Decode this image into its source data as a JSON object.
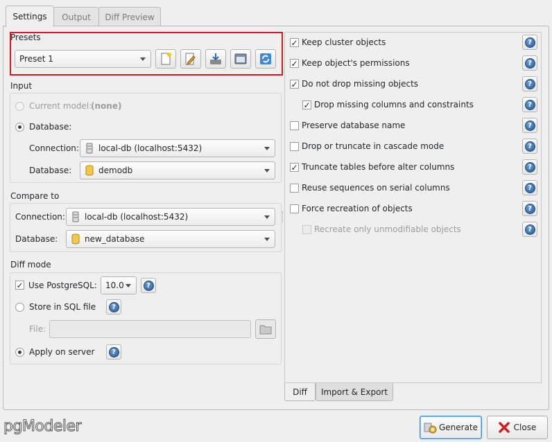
{
  "tabs": [
    {
      "label": "Settings",
      "active": true
    },
    {
      "label": "Output",
      "active": false
    },
    {
      "label": "Diff Preview",
      "active": false
    }
  ],
  "presets": {
    "title": "Presets",
    "selected": "Preset 1",
    "buttons": [
      "new-preset-icon",
      "edit-preset-icon",
      "save-preset-icon",
      "remove-preset-icon",
      "restore-defaults-icon"
    ],
    "highlight_color": "#e0141b"
  },
  "input": {
    "title": "Input",
    "current_model_label": "Current model:",
    "current_model_value": "(none)",
    "database_radio_label": "Database:",
    "connection_label": "Connection:",
    "connection_value": "local-db (localhost:5432)",
    "database_label": "Database:",
    "database_value": "demodb"
  },
  "compare": {
    "title": "Compare to",
    "connection_label": "Connection:",
    "connection_value": "local-db (localhost:5432)",
    "database_label": "Database:",
    "database_value": "new_database"
  },
  "diff_mode": {
    "title": "Diff mode",
    "use_pg_label": "Use PostgreSQL:",
    "pg_version": "10.0",
    "store_sql_label": "Store in SQL file",
    "file_label": "File:",
    "file_value": "",
    "apply_server_label": "Apply on server"
  },
  "options": [
    {
      "label": "Keep cluster objects",
      "checked": true,
      "indent": false,
      "disabled": false
    },
    {
      "label": "Keep object's permissions",
      "checked": true,
      "indent": false,
      "disabled": false
    },
    {
      "label": "Do not drop missing objects",
      "checked": true,
      "indent": false,
      "disabled": false
    },
    {
      "label": "Drop missing columns and constraints",
      "checked": true,
      "indent": true,
      "disabled": false
    },
    {
      "label": "Preserve database name",
      "checked": false,
      "indent": false,
      "disabled": false
    },
    {
      "label": "Drop or truncate in cascade mode",
      "checked": false,
      "indent": false,
      "disabled": false
    },
    {
      "label": "Truncate tables before alter columns",
      "checked": true,
      "indent": false,
      "disabled": false
    },
    {
      "label": "Reuse sequences on serial columns",
      "checked": false,
      "indent": false,
      "disabled": false
    },
    {
      "label": "Force recreation of objects",
      "checked": false,
      "indent": false,
      "disabled": false
    },
    {
      "label": "Recreate only unmodifiable objects",
      "checked": false,
      "indent": true,
      "disabled": true
    }
  ],
  "bottom_tabs": [
    {
      "label": "Diff",
      "active": true
    },
    {
      "label": "Import & Export",
      "active": false
    }
  ],
  "footer": {
    "logo": "pgModeler",
    "generate_label": "Generate",
    "close_label": "Close"
  }
}
